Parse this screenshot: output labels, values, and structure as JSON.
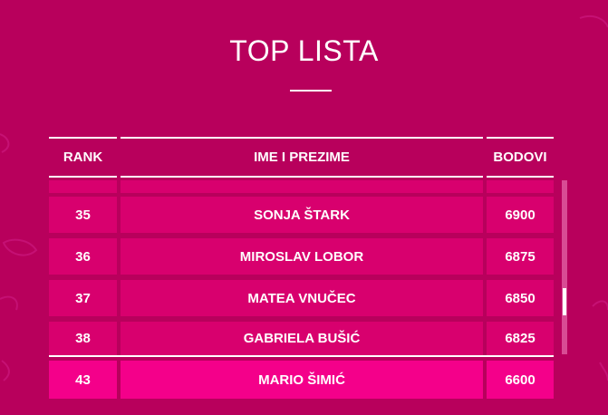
{
  "page": {
    "title": "TOP LISTA"
  },
  "table": {
    "headers": {
      "rank": "RANK",
      "name": "IME I PREZIME",
      "points": "BODOVI"
    },
    "rows": [
      {
        "rank": "35",
        "name": "SONJA ŠTARK",
        "points": "6900"
      },
      {
        "rank": "36",
        "name": "MIROSLAV LOBOR",
        "points": "6875"
      },
      {
        "rank": "37",
        "name": "MATEA VNUČEC",
        "points": "6850"
      },
      {
        "rank": "38",
        "name": "GABRIELA BUŠIĆ",
        "points": "6825"
      }
    ],
    "current_user": {
      "rank": "43",
      "name": "MARIO ŠIMIĆ",
      "points": "6600"
    },
    "scroll_position": 0.62
  },
  "colors": {
    "background": "#b8005c",
    "row": "#d8006e",
    "highlight_row": "#f4008a",
    "text": "#ffffff"
  }
}
